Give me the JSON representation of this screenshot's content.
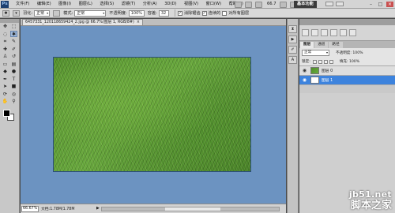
{
  "app": {
    "logo_text": "Ps"
  },
  "menu": [
    "文件(F)",
    "编辑(E)",
    "图像(I)",
    "图层(L)",
    "选择(S)",
    "滤镜(T)",
    "分析(A)",
    "3D(D)",
    "视图(V)",
    "窗口(W)",
    "帮助(H)"
  ],
  "appbar": {
    "zoom": "66.7",
    "workspace": "基本功能"
  },
  "window_controls": {
    "minimize": "–",
    "restore": "□",
    "close": "×"
  },
  "options_bar": {
    "style_label": "羽化:",
    "style_value": "正常",
    "mode_label": "模式:",
    "mode_value": "正常",
    "opacity_label": "不透明度:",
    "opacity_value": "100%",
    "tolerance_label": "容差:",
    "tolerance_value": "32",
    "anti_alias_label": "消除锯齿",
    "contiguous_label": "连续的",
    "all_layers_label": "对所有图层"
  },
  "document": {
    "tab_title": "6457331_120118659424_2.jpg @ 66.7%(图层 1, RGB/8#)",
    "close_glyph": "×"
  },
  "status_bar": {
    "zoom": "66.67%",
    "doc_info": "文档:1.78M/1.78M",
    "arrow": "▶"
  },
  "layers_panel": {
    "tabs": [
      "图层",
      "通道",
      "路径"
    ],
    "blend_mode": "正常",
    "opacity_label": "不透明度: 100%",
    "lock_label": "锁定:",
    "fill_label": "填充: 100%",
    "layers": [
      {
        "name": "图层 0",
        "thumbnail": "grass",
        "selected": false
      },
      {
        "name": "图层 1",
        "thumbnail": "white",
        "selected": true
      }
    ]
  },
  "watermark": {
    "site": "jb51.net",
    "text_cn": "脚本之家"
  },
  "colors": {
    "canvas_bg": "#6c93c1",
    "selected_layer": "#3d83dd",
    "grass": "#5a9a33"
  }
}
